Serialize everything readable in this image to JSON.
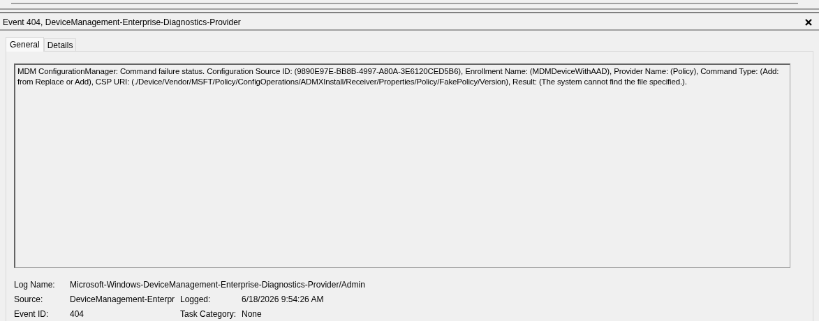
{
  "window": {
    "title": "Event 404, DeviceManagement-Enterprise-Diagnostics-Provider"
  },
  "tabs": [
    {
      "label": "General",
      "selected": true
    },
    {
      "label": "Details",
      "selected": false
    }
  ],
  "description": "MDM ConfigurationManager: Command failure status. Configuration Source ID: (9890E97E-BB8B-4997-A80A-3E6120CED5B6), Enrollment Name: (MDMDeviceWithAAD), Provider Name: (Policy), Command Type: (Add: from Replace or Add), CSP URI: (./Device/Vendor/MSFT/Policy/ConfigOperations/ADMXInstall/Receiver/Properties/Policy/FakePolicy/Version), Result: (The system cannot find the file specified.).",
  "properties": [
    [
      {
        "label": "Log Name:",
        "value": "Microsoft-Windows-DeviceManagement-Enterprise-Diagnostics-Provider/Admin"
      }
    ],
    [
      {
        "label": "Source:",
        "value": "DeviceManagement-Enterpr"
      },
      {
        "label": "Logged:",
        "value": "6/18/2026 9:54:26 AM"
      }
    ],
    [
      {
        "label": "Event ID:",
        "value": "404"
      },
      {
        "label": "Task Category:",
        "value": "None"
      }
    ]
  ]
}
